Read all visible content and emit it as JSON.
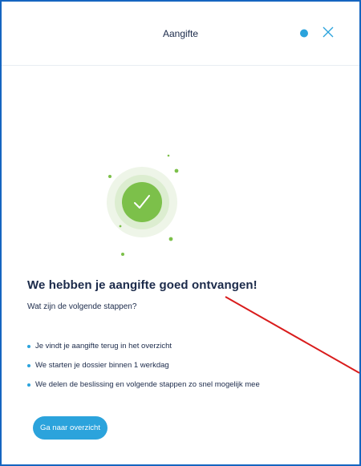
{
  "header": {
    "title": "Aangifte",
    "status_icon": "status-dot",
    "close_icon": "close-icon"
  },
  "success": {
    "icon": "checkmark-icon",
    "heading": "We hebben je aangifte goed ontvangen!",
    "subheading": "Wat zijn de volgende stappen?",
    "steps": [
      "Je vindt je aangifte terug in het overzicht",
      "We starten je dossier binnen 1 werkdag",
      "We delen de beslissing en volgende stappen zo snel mogelijk mee"
    ]
  },
  "actions": {
    "overview_button": "Ga naar overzicht"
  },
  "colors": {
    "accent": "#2ba3dc",
    "success_green": "#7cc04a",
    "frame_border": "#1565c0",
    "annotation_red": "#d91c1c",
    "heading_text": "#1b2a4a"
  }
}
